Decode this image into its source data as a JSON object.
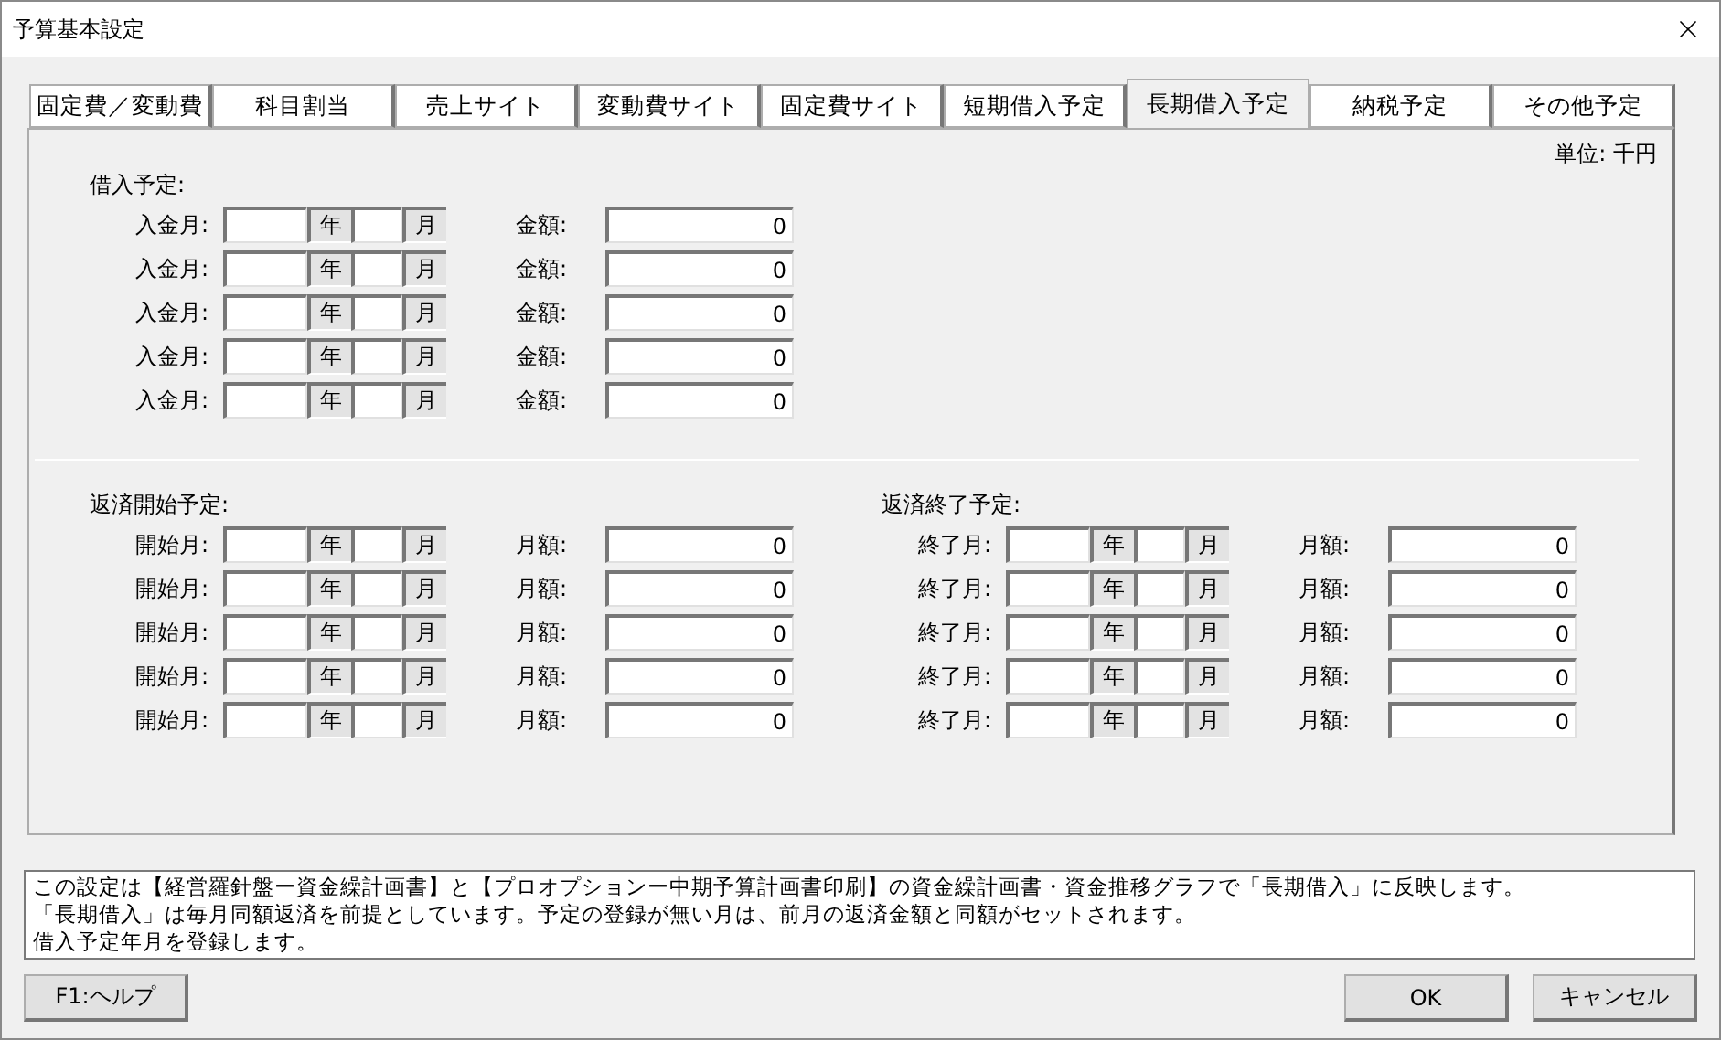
{
  "window": {
    "title": "予算基本設定"
  },
  "tabs": [
    {
      "label": "固定費／変動費",
      "selected": false
    },
    {
      "label": "科目割当",
      "selected": false
    },
    {
      "label": "売上サイト",
      "selected": false
    },
    {
      "label": "変動費サイト",
      "selected": false
    },
    {
      "label": "固定費サイト",
      "selected": false
    },
    {
      "label": "短期借入予定",
      "selected": false
    },
    {
      "label": "長期借入予定",
      "selected": true
    },
    {
      "label": "納税予定",
      "selected": false
    },
    {
      "label": "その他予定",
      "selected": false
    }
  ],
  "unit": "単位: 千円",
  "borrow": {
    "heading": "借入予定:",
    "rows": [
      {
        "label": "入金月:",
        "year_unit": "年",
        "month_unit": "月",
        "amount_label": "金額:",
        "amount": "0"
      },
      {
        "label": "入金月:",
        "year_unit": "年",
        "month_unit": "月",
        "amount_label": "金額:",
        "amount": "0"
      },
      {
        "label": "入金月:",
        "year_unit": "年",
        "month_unit": "月",
        "amount_label": "金額:",
        "amount": "0"
      },
      {
        "label": "入金月:",
        "year_unit": "年",
        "month_unit": "月",
        "amount_label": "金額:",
        "amount": "0"
      },
      {
        "label": "入金月:",
        "year_unit": "年",
        "month_unit": "月",
        "amount_label": "金額:",
        "amount": "0"
      }
    ]
  },
  "repay_start": {
    "heading": "返済開始予定:",
    "rows": [
      {
        "label": "開始月:",
        "year_unit": "年",
        "month_unit": "月",
        "amount_label": "月額:",
        "amount": "0"
      },
      {
        "label": "開始月:",
        "year_unit": "年",
        "month_unit": "月",
        "amount_label": "月額:",
        "amount": "0"
      },
      {
        "label": "開始月:",
        "year_unit": "年",
        "month_unit": "月",
        "amount_label": "月額:",
        "amount": "0"
      },
      {
        "label": "開始月:",
        "year_unit": "年",
        "month_unit": "月",
        "amount_label": "月額:",
        "amount": "0"
      },
      {
        "label": "開始月:",
        "year_unit": "年",
        "month_unit": "月",
        "amount_label": "月額:",
        "amount": "0"
      }
    ]
  },
  "repay_end": {
    "heading": "返済終了予定:",
    "rows": [
      {
        "label": "終了月:",
        "year_unit": "年",
        "month_unit": "月",
        "amount_label": "月額:",
        "amount": "0"
      },
      {
        "label": "終了月:",
        "year_unit": "年",
        "month_unit": "月",
        "amount_label": "月額:",
        "amount": "0"
      },
      {
        "label": "終了月:",
        "year_unit": "年",
        "month_unit": "月",
        "amount_label": "月額:",
        "amount": "0"
      },
      {
        "label": "終了月:",
        "year_unit": "年",
        "month_unit": "月",
        "amount_label": "月額:",
        "amount": "0"
      },
      {
        "label": "終了月:",
        "year_unit": "年",
        "month_unit": "月",
        "amount_label": "月額:",
        "amount": "0"
      }
    ]
  },
  "note": [
    "この設定は【経営羅針盤ー資金繰計画書】と【プロオプションー中期予算計画書印刷】の資金繰計画書・資金推移グラフで「長期借入」に反映します。",
    "「長期借入」は毎月同額返済を前提としています。予定の登録が無い月は、前月の返済金額と同額がセットされます。",
    "借入予定年月を登録します。"
  ],
  "buttons": {
    "help": "F1:ヘルプ",
    "ok": "OK",
    "cancel": "キャンセル"
  }
}
